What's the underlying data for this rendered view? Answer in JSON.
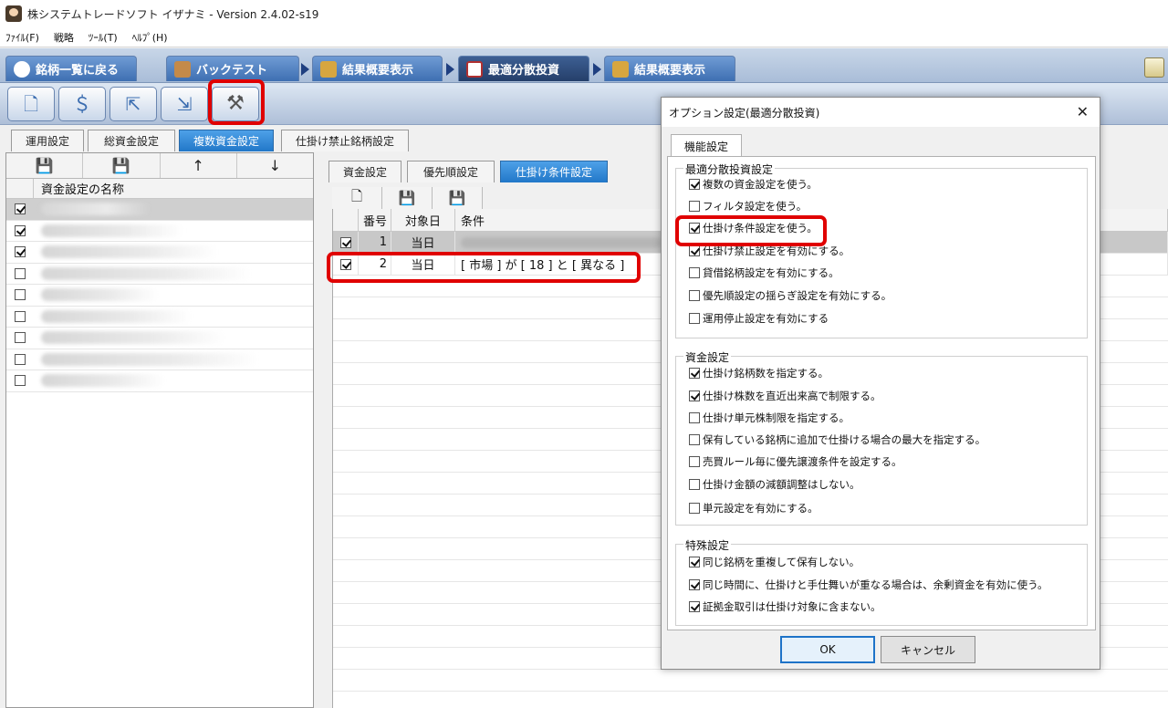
{
  "window": {
    "title": "株システムトレードソフト イザナミ - Version 2.4.02-s19"
  },
  "menu": [
    "ﾌｧｲﾙ(F)",
    "戦略",
    "ﾂｰﾙ(T)",
    "ﾍﾙﾌﾟ(H)"
  ],
  "nav": {
    "back": "銘柄一覧に戻る",
    "backtest": "バックテスト",
    "result1": "結果概要表示",
    "optimal": "最適分散投資",
    "result2": "結果概要表示"
  },
  "toolbar": {
    "icons": [
      "new-file-icon",
      "money-icon",
      "export-icon",
      "import-icon",
      "tools-icon"
    ]
  },
  "subtabs": [
    "運用設定",
    "総資金設定",
    "複数資金設定",
    "仕掛け禁止銘柄設定"
  ],
  "left_panel": {
    "tools": [
      "💾",
      "💾",
      "↑",
      "↓"
    ],
    "header": "資金設定の名称",
    "rows": [
      {
        "checked": true
      },
      {
        "checked": true
      },
      {
        "checked": true
      },
      {
        "checked": false
      },
      {
        "checked": false
      },
      {
        "checked": false
      },
      {
        "checked": false
      },
      {
        "checked": false
      },
      {
        "checked": false
      }
    ]
  },
  "right_tabs": [
    "資金設定",
    "優先順設定",
    "仕掛け条件設定"
  ],
  "grid": {
    "headers": [
      "番号",
      "対象日",
      "条件"
    ],
    "rows": [
      {
        "checked": true,
        "num": "1",
        "day": "当日",
        "cond": ""
      },
      {
        "checked": true,
        "num": "2",
        "day": "当日",
        "cond": "[ 市場 ] が [ 18 ] と [ 異なる ]"
      }
    ]
  },
  "dialog": {
    "title": "オプション設定(最適分散投資)",
    "tab": "機能設定",
    "groups": [
      {
        "title": "最適分散投資設定",
        "options": [
          {
            "label": "複数の資金設定を使う。",
            "checked": true
          },
          {
            "label": "フィルタ設定を使う。",
            "checked": false
          },
          {
            "label": "仕掛け条件設定を使う。",
            "checked": true
          },
          {
            "label": "仕掛け禁止設定を有効にする。",
            "checked": true
          },
          {
            "label": "貸借銘柄設定を有効にする。",
            "checked": false
          },
          {
            "label": "優先順設定の揺らぎ設定を有効にする。",
            "checked": false
          },
          {
            "label": "運用停止設定を有効にする",
            "checked": false
          }
        ]
      },
      {
        "title": "資金設定",
        "options": [
          {
            "label": "仕掛け銘柄数を指定する。",
            "checked": true
          },
          {
            "label": "仕掛け株数を直近出来高で制限する。",
            "checked": true
          },
          {
            "label": "仕掛け単元株制限を指定する。",
            "checked": false
          },
          {
            "label": "保有している銘柄に追加で仕掛ける場合の最大を指定する。",
            "checked": false
          },
          {
            "label": "売買ルール毎に優先譲渡条件を設定する。",
            "checked": false
          },
          {
            "label": "仕掛け金額の減額調整はしない。",
            "checked": false
          },
          {
            "label": "単元設定を有効にする。",
            "checked": false
          }
        ]
      },
      {
        "title": "特殊設定",
        "options": [
          {
            "label": "同じ銘柄を重複して保有しない。",
            "checked": true
          },
          {
            "label": "同じ時間に、仕掛けと手仕舞いが重なる場合は、余剰資金を有効に使う。",
            "checked": true
          },
          {
            "label": "証拠金取引は仕掛け対象に含まない。",
            "checked": true
          }
        ]
      }
    ],
    "ok": "OK",
    "cancel": "キャンセル"
  }
}
